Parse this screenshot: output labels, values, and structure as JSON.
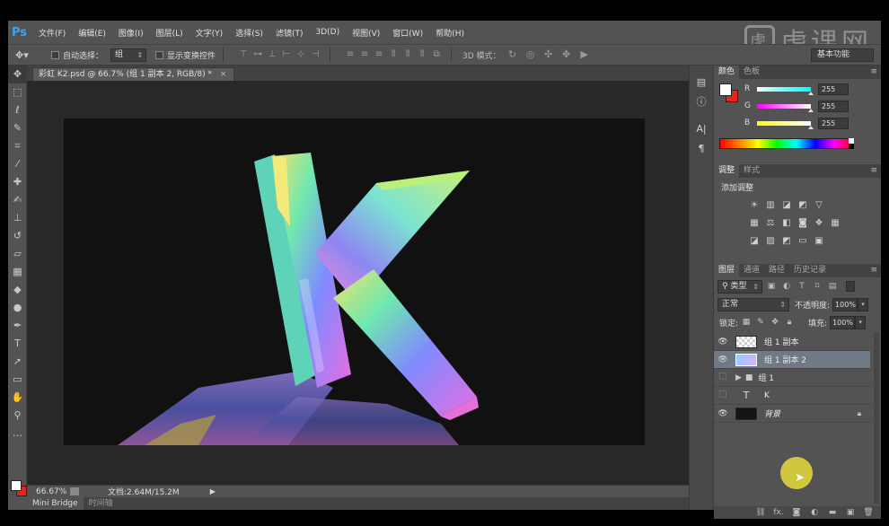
{
  "app": {
    "logo": "Ps",
    "menu": [
      "文件(F)",
      "编辑(E)",
      "图像(I)",
      "图层(L)",
      "文字(Y)",
      "选择(S)",
      "滤镜(T)",
      "3D(D)",
      "视图(V)",
      "窗口(W)",
      "帮助(H)"
    ],
    "brand": "虎课网"
  },
  "options": {
    "auto_select_label": "自动选择：",
    "auto_select_value": "组",
    "show_transform_label": "显示变换控件",
    "mode3d_label": "3D 模式：",
    "workspace": "基本功能"
  },
  "document": {
    "tab_title": "彩虹 K2.psd @ 66.7% (组 1 副本 2, RGB/8) *",
    "close": "×",
    "zoom": "66.67%",
    "doc_size": "文档:2.64M/15.2M",
    "canvas_letter": "K"
  },
  "bottom_tabs": [
    "Mini Bridge",
    "时间轴"
  ],
  "panels": {
    "color_tabs": [
      "颜色",
      "色板"
    ],
    "color": {
      "channels": [
        {
          "label": "R",
          "value": "255",
          "gradient": "linear-gradient(to right, #ffffff, #7fffff 40%, #00ffff)"
        },
        {
          "label": "G",
          "value": "255",
          "gradient": "linear-gradient(to right, #ff00ff, #ffffff)"
        },
        {
          "label": "B",
          "value": "255",
          "gradient": "linear-gradient(to right, #ffff00, #ffffff)"
        }
      ]
    },
    "adjust_tabs": [
      "调整",
      "样式"
    ],
    "adjust_title": "添加调整",
    "layers_tabs": [
      "图层",
      "通道",
      "路径",
      "历史记录"
    ],
    "layers": {
      "kind": "类型",
      "blend_mode": "正常",
      "opacity_label": "不透明度:",
      "opacity": "100%",
      "lock_label": "锁定:",
      "fill_label": "填充:",
      "fill": "100%",
      "items": [
        {
          "name": "组 1 副本",
          "thumb": "checker",
          "visible": true,
          "selected": false
        },
        {
          "name": "组 1 副本 2",
          "thumb": "blue",
          "visible": true,
          "selected": true
        },
        {
          "name": "组 1",
          "thumb": "folder",
          "visible": false,
          "selected": false
        },
        {
          "name": "K",
          "thumb": "text",
          "visible": false,
          "selected": false
        },
        {
          "name": "背景",
          "thumb": "dark",
          "visible": true,
          "selected": false,
          "locked": true
        }
      ]
    }
  },
  "colors": {
    "foreground": "#ffffff",
    "background": "#e8231f",
    "ui_bg": "#535353",
    "canvas_bg": "#111111",
    "selected_layer": "#6f7a86"
  }
}
